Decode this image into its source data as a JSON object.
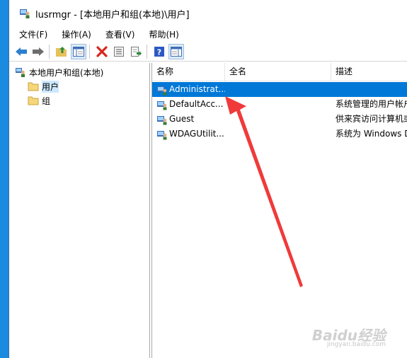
{
  "window": {
    "title": "lusrmgr - [本地用户和组(本地)\\用户]"
  },
  "menu": [
    "文件(F)",
    "操作(A)",
    "查看(V)",
    "帮助(H)"
  ],
  "toolbar": {
    "icons": [
      "back-arrow-icon",
      "forward-arrow-icon",
      "up-folder-icon",
      "show-tree-icon",
      "delete-icon",
      "properties-icon",
      "export-icon",
      "help-icon",
      "show-action-pane-icon"
    ]
  },
  "tree": {
    "root": "本地用户和组(本地)",
    "items": [
      "用户",
      "组"
    ]
  },
  "columns": {
    "name": "名称",
    "fullname": "全名",
    "description": "描述"
  },
  "users": [
    {
      "name": "Administrat...",
      "fullname": "",
      "description": "",
      "selected": true
    },
    {
      "name": "DefaultAcc...",
      "fullname": "",
      "description": "系统管理的用户帐户"
    },
    {
      "name": "Guest",
      "fullname": "",
      "description": "供来宾访问计算机或"
    },
    {
      "name": "WDAGUtilit...",
      "fullname": "",
      "description": "系统为 Windows Def"
    }
  ],
  "watermark": {
    "brand": "Baidu经验",
    "url": "jingyan.baidu.com"
  },
  "colors": {
    "selection": "#0078d7",
    "desktop": "#1b8be0",
    "arrow": "#f03a3a"
  }
}
